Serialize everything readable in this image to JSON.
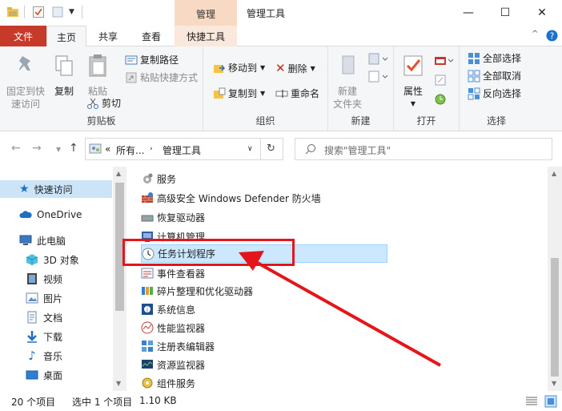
{
  "window": {
    "title": "管理工具",
    "context_tab_header": "管理",
    "controls": {
      "minimize": "—",
      "maximize": "☐",
      "close": "✕"
    }
  },
  "tabs": [
    {
      "label": "文件"
    },
    {
      "label": "主页"
    },
    {
      "label": "共享"
    },
    {
      "label": "查看"
    },
    {
      "label": "快捷工具"
    }
  ],
  "ribbon": {
    "clipboard": {
      "label": "剪贴板",
      "pin": "固定到快速访问",
      "pin_line1": "固定到快",
      "pin_line2": "速访问",
      "copy": "复制",
      "paste": "粘贴",
      "copy_path": "复制路径",
      "paste_shortcut": "粘贴快捷方式",
      "cut": "剪切"
    },
    "organize": {
      "label": "组织",
      "move_to": "移动到",
      "copy_to": "复制到",
      "delete": "删除",
      "rename": "重命名"
    },
    "new": {
      "label": "新建",
      "new_folder_line1": "新建",
      "new_folder_line2": "文件夹"
    },
    "open": {
      "label": "打开",
      "properties": "属性"
    },
    "select": {
      "label": "选择",
      "select_all": "全部选择",
      "select_none": "全部取消",
      "invert": "反向选择"
    }
  },
  "address": {
    "prefix": "«",
    "segment1": "所有...",
    "segment2": "管理工具",
    "search_placeholder": "搜索\"管理工具\""
  },
  "nav_items": [
    {
      "label": "快速访问"
    },
    {
      "label": "OneDrive"
    },
    {
      "label": "此电脑"
    },
    {
      "label": "3D 对象"
    },
    {
      "label": "视频"
    },
    {
      "label": "图片"
    },
    {
      "label": "文档"
    },
    {
      "label": "下载"
    },
    {
      "label": "音乐"
    },
    {
      "label": "桌面"
    }
  ],
  "files": [
    {
      "label": "服务"
    },
    {
      "label": "高级安全 Windows Defender 防火墙"
    },
    {
      "label": "恢复驱动器"
    },
    {
      "label": "计算机管理"
    },
    {
      "label": "任务计划程序"
    },
    {
      "label": "事件查看器"
    },
    {
      "label": "碎片整理和优化驱动器"
    },
    {
      "label": "系统信息"
    },
    {
      "label": "性能监视器"
    },
    {
      "label": "注册表编辑器"
    },
    {
      "label": "资源监视器"
    },
    {
      "label": "组件服务"
    }
  ],
  "status": {
    "count": "20 个项目",
    "selected": "选中 1 个项目",
    "size": "1.10 KB"
  },
  "colors": {
    "file_tab": "#c73a2a",
    "context_tab": "#f7d9c4",
    "selection": "#cce8ff",
    "annotation": "#e4161c"
  }
}
